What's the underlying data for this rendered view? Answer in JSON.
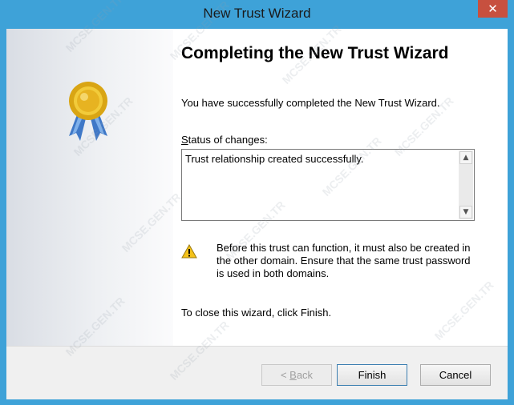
{
  "window": {
    "title": "New Trust Wizard",
    "close_glyph": "✕"
  },
  "heading": "Completing the New Trust Wizard",
  "success_text": "You have successfully completed the New Trust Wizard.",
  "status": {
    "label_accel": "S",
    "label_rest": "tatus of changes:",
    "text": "Trust relationship created successfully."
  },
  "warning": {
    "icon": "warning-icon",
    "text": "Before this trust can function, it must also be created in the other domain. Ensure that the same trust password is used in both domains."
  },
  "close_hint": "To close this wizard, click Finish.",
  "buttons": {
    "back_prefix": "< ",
    "back_accel": "B",
    "back_rest": "ack",
    "finish": "Finish",
    "cancel": "Cancel"
  },
  "watermark": "MCSE.GEN.TR",
  "colors": {
    "titlebar": "#3ea2d8",
    "close": "#c7503f",
    "accent": "#3c7fb1"
  }
}
